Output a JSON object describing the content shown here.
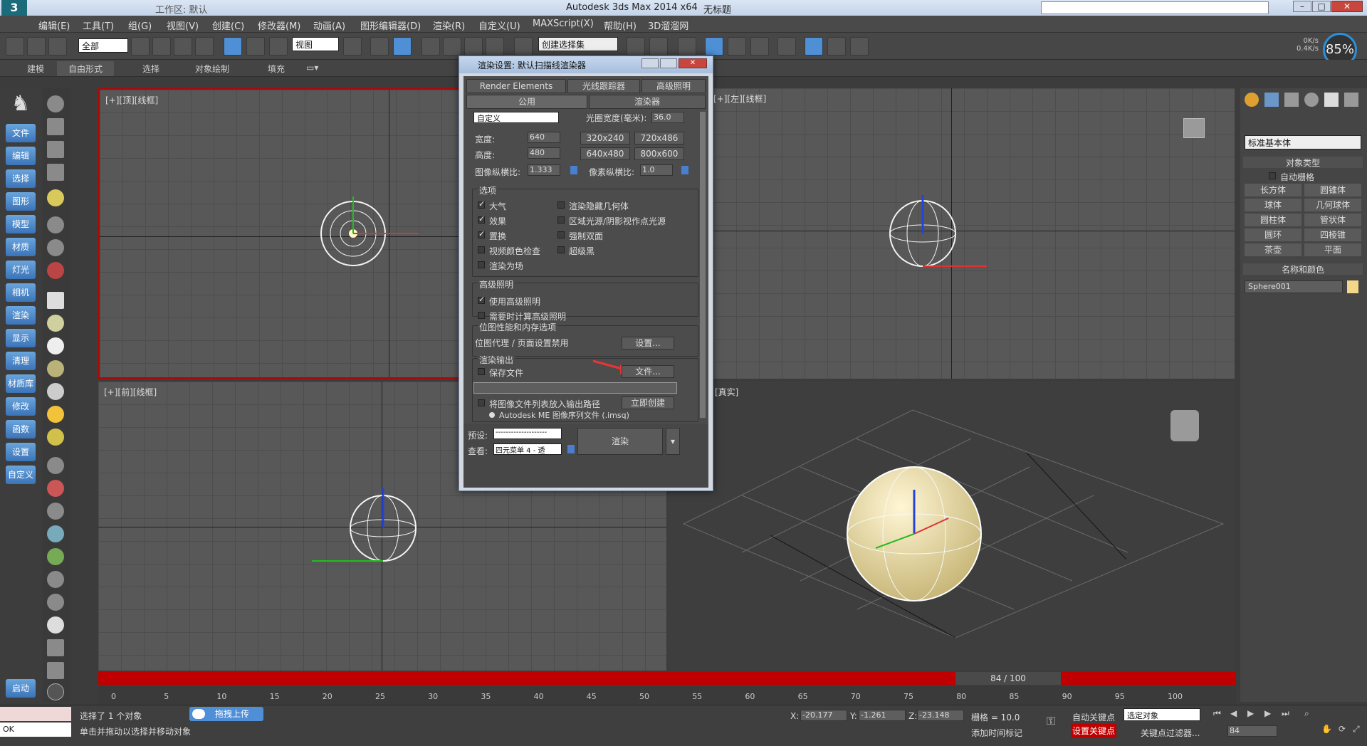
{
  "titlebar": {
    "workspace": "工作区: 默认",
    "app_title": "Autodesk 3ds Max  2014 x64",
    "doc_title": "无标题"
  },
  "menu": [
    "编辑(E)",
    "工具(T)",
    "组(G)",
    "视图(V)",
    "创建(C)",
    "修改器(M)",
    "动画(A)",
    "图形编辑器(D)",
    "渲染(R)",
    "自定义(U)",
    "MAXScript(X)",
    "帮助(H)",
    "3D溜溜网"
  ],
  "toolbar": {
    "filter_select": "全部",
    "ref_coord": "视图",
    "named_set": "创建选择集",
    "net_up": "0K/s",
    "net_down": "0.4K/s",
    "cpu": "85%"
  },
  "ribbon": [
    "建模",
    "自由形式",
    "选择",
    "对象绘制",
    "填充"
  ],
  "leftbar": [
    "文件",
    "编辑",
    "选择",
    "图形",
    "模型",
    "材质",
    "灯光",
    "相机",
    "渲染",
    "显示",
    "清理",
    "材质库",
    "修改",
    "函数",
    "设置",
    "自定义",
    "启动"
  ],
  "viewports": {
    "top": "[+][顶][线框]",
    "front": "[+][前][线框]",
    "left": "[+][左][线框]",
    "persp": "[真实]"
  },
  "dialog": {
    "title": "渲染设置: 默认扫描线渲染器",
    "tabs_row1": [
      "Render Elements",
      "光线跟踪器",
      "高级照明"
    ],
    "tabs_row2": [
      "公用",
      "渲染器"
    ],
    "preset_size": "自定义",
    "aperture_label": "光圈宽度(毫米):",
    "aperture_value": "36.0",
    "width_label": "宽度:",
    "width_value": "640",
    "height_label": "高度:",
    "height_value": "480",
    "res_buttons": [
      "320x240",
      "720x486",
      "640x480",
      "800x600"
    ],
    "img_aspect_label": "图像纵横比:",
    "img_aspect_value": "1.333",
    "pix_aspect_label": "像素纵横比:",
    "pix_aspect_value": "1.0",
    "options_title": "选项",
    "options_left": [
      {
        "label": "大气",
        "checked": true
      },
      {
        "label": "效果",
        "checked": true
      },
      {
        "label": "置换",
        "checked": true
      },
      {
        "label": "视频颜色检查",
        "checked": false
      },
      {
        "label": "渲染为场",
        "checked": false
      }
    ],
    "options_right": [
      {
        "label": "渲染隐藏几何体",
        "checked": false
      },
      {
        "label": "区域光源/阴影视作点光源",
        "checked": false
      },
      {
        "label": "强制双面",
        "checked": false
      },
      {
        "label": "超级黑",
        "checked": false
      }
    ],
    "advlight_title": "高级照明",
    "advlight": [
      {
        "label": "使用高级照明",
        "checked": true
      },
      {
        "label": "需要时计算高级照明",
        "checked": false
      }
    ],
    "bitmap_title": "位图性能和内存选项",
    "bitmap_text": "位图代理 / 页面设置禁用",
    "bitmap_btn": "设置...",
    "output_title": "渲染输出",
    "save_file": "保存文件",
    "file_btn": "文件...",
    "list_path": "将图像文件列表放入输出路径",
    "create_now": "立即创建",
    "imsq": "Autodesk ME 图像序列文件 (.imsq)",
    "preset_label": "预设:",
    "preset_value": "--------------------",
    "view_label": "查看:",
    "view_value": "四元菜单 4 - 透",
    "render_btn": "渲染"
  },
  "cmdpanel": {
    "category": "标准基本体",
    "obj_type": "对象类型",
    "autogrid": "自动栅格",
    "buttons": [
      "长方体",
      "圆锥体",
      "球体",
      "几何球体",
      "圆柱体",
      "管状体",
      "圆环",
      "四棱锥",
      "茶壶",
      "平面"
    ],
    "name_color": "名称和颜色",
    "obj_name": "Sphere001"
  },
  "timeline": {
    "frame": "84 / 100",
    "ticks": [
      "0",
      "5",
      "10",
      "15",
      "20",
      "25",
      "30",
      "35",
      "40",
      "45",
      "50",
      "55",
      "60",
      "65",
      "70",
      "75",
      "80",
      "85",
      "90",
      "95",
      "100"
    ]
  },
  "status": {
    "selected": "选择了 1 个对象",
    "hint": "单击并拖动以选择并移动对象",
    "upload": "拖拽上传",
    "x_label": "X:",
    "x": "-20.177",
    "y_label": "Y:",
    "y": "-1.261",
    "z_label": "Z:",
    "z": "-23.148",
    "grid": "栅格 = 10.0",
    "autokey": "自动关键点",
    "keymode": "选定对象",
    "setkey": "设置关键点",
    "keyfilter": "关键点过滤器...",
    "add_tag": "添加时间标记",
    "frame_field": "84",
    "listener": "OK"
  }
}
